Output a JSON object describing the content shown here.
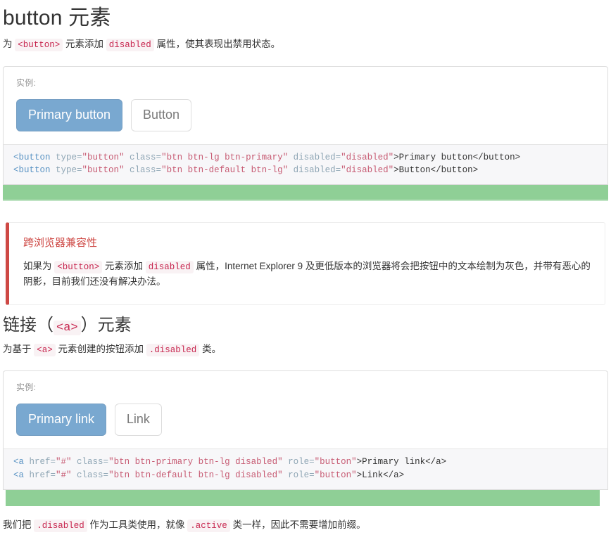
{
  "button_section": {
    "heading_text": "button 元素",
    "lead": {
      "before": "为 ",
      "code1": "<button>",
      "middle": " 元素添加 ",
      "code2": "disabled",
      "after": " 属性，使其表现出禁用状态。"
    },
    "example": {
      "label": "实例:",
      "primary_button": "Primary button",
      "default_button": "Button"
    },
    "code": {
      "line1": {
        "tag_open": "<button",
        "attr_type": " type=",
        "val_type": "\"button\"",
        "attr_class": " class=",
        "val_class": "\"btn btn-lg btn-primary\"",
        "attr_disabled": " disabled=",
        "val_disabled": "\"disabled\"",
        "content": ">Primary button</button>"
      },
      "line2": {
        "tag_open": "<button",
        "attr_type": " type=",
        "val_type": "\"button\"",
        "attr_class": " class=",
        "val_class": "\"btn btn-default btn-lg\"",
        "attr_disabled": " disabled=",
        "val_disabled": "\"disabled\"",
        "content": ">Button</button>"
      }
    }
  },
  "callout": {
    "title": "跨浏览器兼容性",
    "body": {
      "part1": "如果为 ",
      "code1": "<button>",
      "part2": " 元素添加 ",
      "code2": "disabled",
      "part3": " 属性，Internet Explorer 9 及更低版本的浏览器将会把按钮中的文本绘制为灰色，并带有恶心的阴影，目前我们还没有解决办法。"
    },
    "accent_color": "#ce4844"
  },
  "link_section": {
    "heading": {
      "before": "链接（",
      "code": "<a>",
      "after": "）元素"
    },
    "lead": {
      "before": "为基于 ",
      "code1": "<a>",
      "middle": " 元素创建的按钮添加 ",
      "code2": ".disabled",
      "after": " 类。"
    },
    "example": {
      "label": "实例:",
      "primary_link": "Primary link",
      "default_link": "Link"
    },
    "code": {
      "line1": {
        "tag_open": "<a",
        "attr_href": " href=",
        "val_href": "\"#\"",
        "attr_class": " class=",
        "val_class": "\"btn btn-primary btn-lg disabled\"",
        "attr_role": " role=",
        "val_role": "\"button\"",
        "content": ">Primary link</a>"
      },
      "line2": {
        "tag_open": "<a",
        "attr_href": " href=",
        "val_href": "\"#\"",
        "attr_class": " class=",
        "val_class": "\"btn btn-default btn-lg disabled\"",
        "attr_role": " role=",
        "val_role": "\"button\"",
        "content": ">Link</a>"
      }
    }
  },
  "trailing_note": {
    "part1": "我们把 ",
    "code1": ".disabled",
    "part2": " 作为工具类使用，就像 ",
    "code2": ".active",
    "part3": " 类一样，因此不需要增加前缀。"
  },
  "colors": {
    "primary_button": "#337ab7",
    "code_text": "#c7254e",
    "code_bg": "#f9f2f4",
    "green_bar": "#8fcf96",
    "callout_red": "#ce4844"
  }
}
